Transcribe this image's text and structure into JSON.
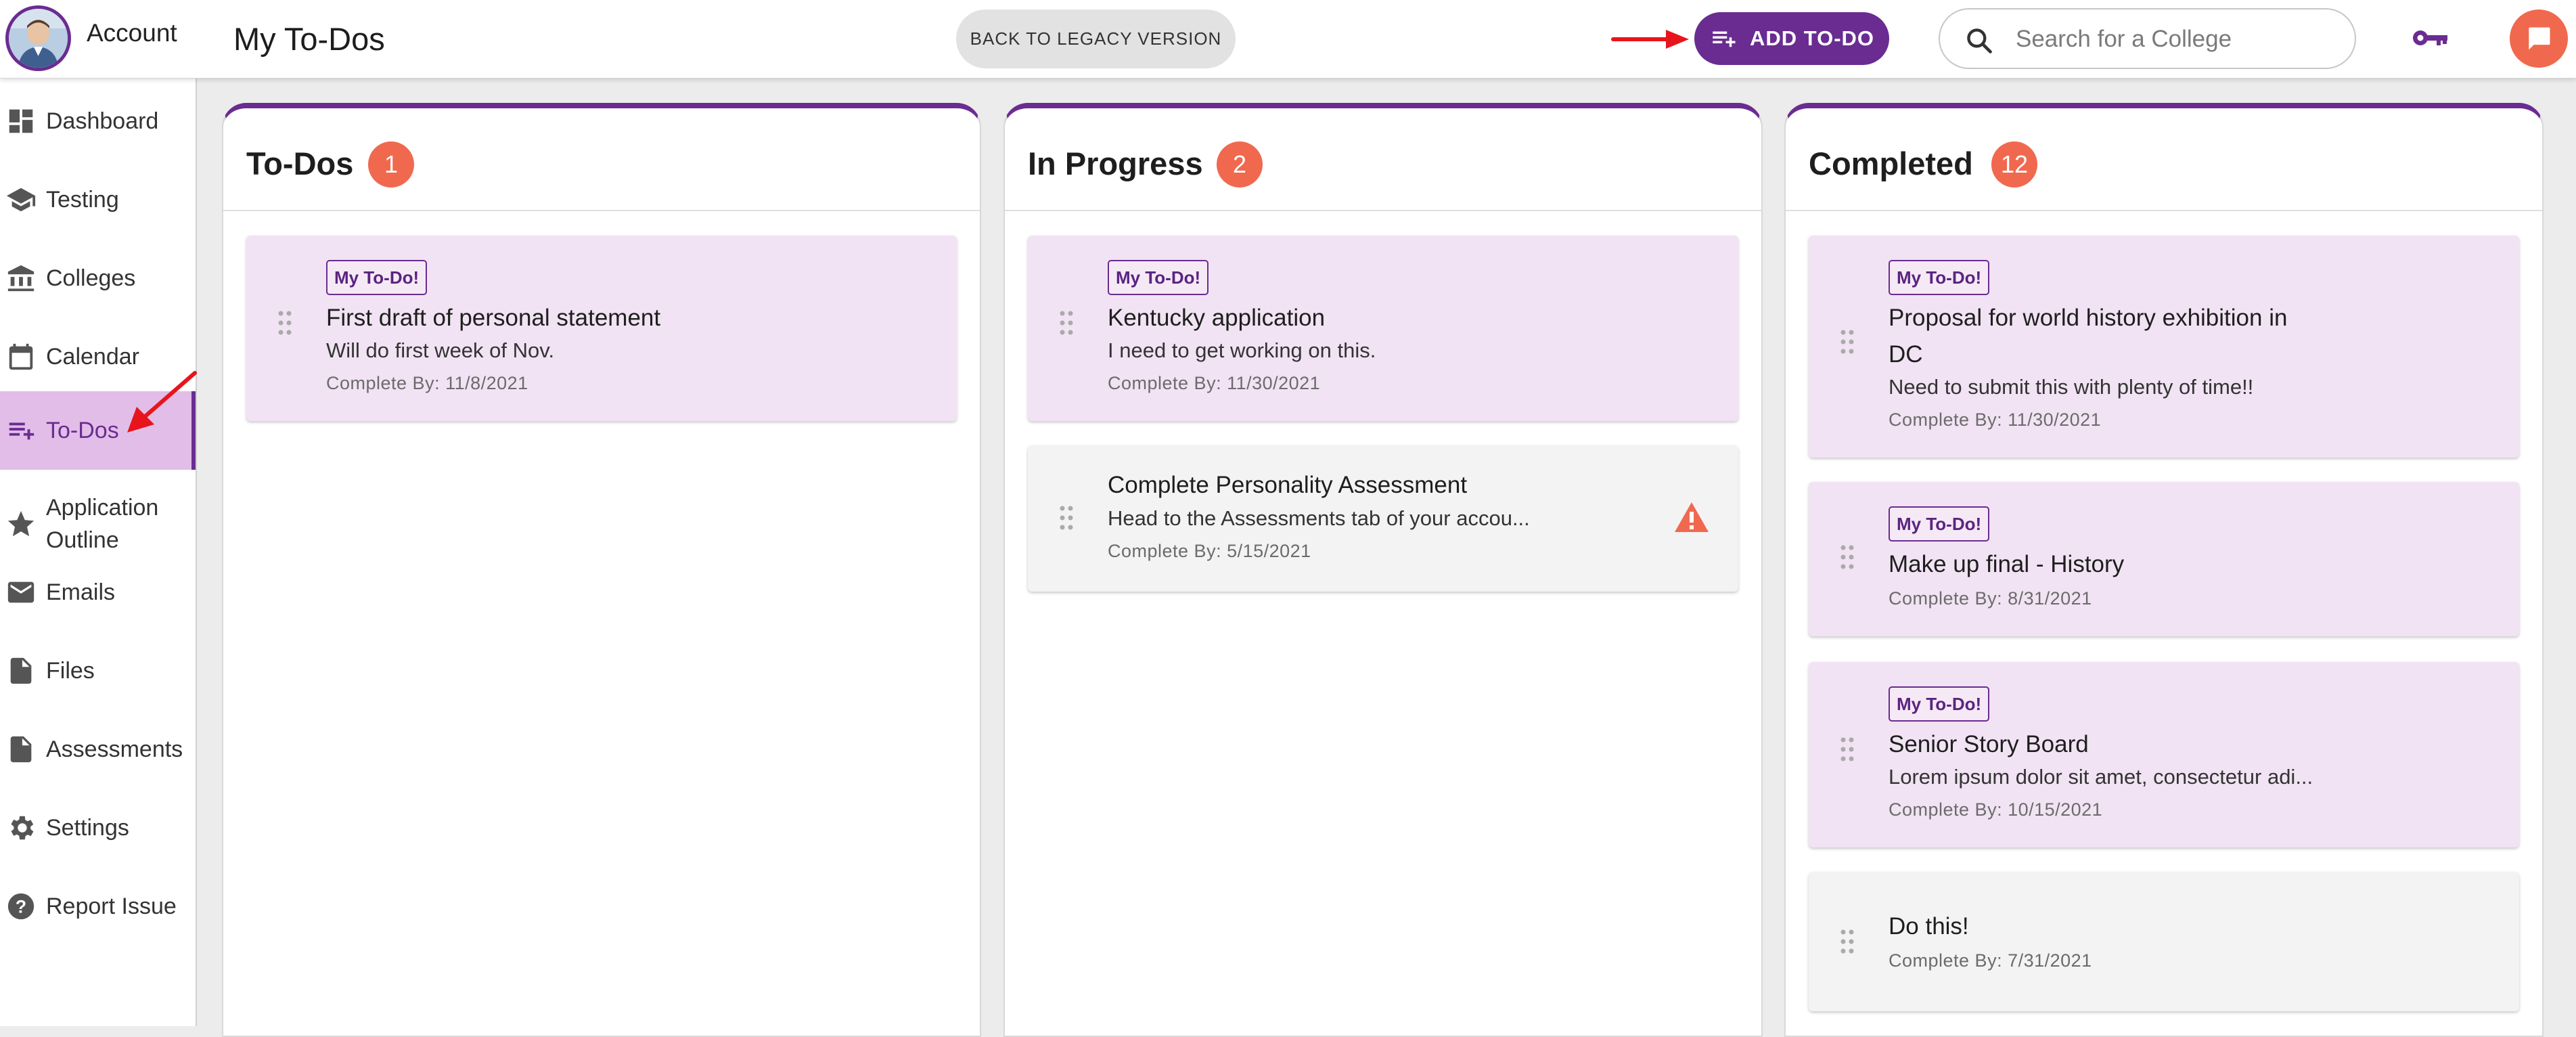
{
  "header": {
    "account_label": "Account",
    "page_title": "My To-Dos",
    "legacy_button": "BACK TO LEGACY VERSION",
    "add_button": "ADD TO-DO",
    "search_placeholder": "Search for a College"
  },
  "sidebar": {
    "items": [
      {
        "label": "Dashboard",
        "icon": "dashboard-icon"
      },
      {
        "label": "Testing",
        "icon": "graduation-cap-icon"
      },
      {
        "label": "Colleges",
        "icon": "bank-icon"
      },
      {
        "label": "Calendar",
        "icon": "calendar-icon"
      },
      {
        "label": "To-Dos",
        "icon": "playlist-add-icon",
        "active": true
      },
      {
        "label": "Application Outline",
        "icon": "star-icon"
      },
      {
        "label": "Emails",
        "icon": "mail-icon"
      },
      {
        "label": "Files",
        "icon": "file-icon"
      },
      {
        "label": "Assessments",
        "icon": "file-icon"
      },
      {
        "label": "Settings",
        "icon": "gear-icon"
      },
      {
        "label": "Report Issue",
        "icon": "help-icon"
      }
    ]
  },
  "columns": [
    {
      "title": "To-Dos",
      "count": "1",
      "cards": [
        {
          "tag": "My To-Do!",
          "title": "First draft of personal statement",
          "desc": "Will do first week of Nov.",
          "date": "Complete By: 11/8/2021"
        }
      ]
    },
    {
      "title": "In Progress",
      "count": "2",
      "cards": [
        {
          "tag": "My To-Do!",
          "title": "Kentucky application",
          "desc": "I need to get working on this.",
          "date": "Complete By: 11/30/2021"
        },
        {
          "title": "Complete Personality Assessment",
          "desc": "Head to the Assessments tab of your accou...",
          "date": "Complete By: 5/15/2021"
        }
      ]
    },
    {
      "title": "Completed",
      "count": "12",
      "cards": [
        {
          "tag": "My To-Do!",
          "title": "Proposal for world history exhibition in DC",
          "desc": "Need to submit this with plenty of time!!",
          "date": "Complete By: 11/30/2021"
        },
        {
          "tag": "My To-Do!",
          "title": "Make up final - History",
          "date": "Complete By: 8/31/2021"
        },
        {
          "tag": "My To-Do!",
          "title": "Senior Story Board",
          "desc": "Lorem ipsum dolor sit amet, consectetur adi...",
          "date": "Complete By: 10/15/2021"
        },
        {
          "title": "Do this!",
          "date": "Complete By: 7/31/2021"
        }
      ]
    }
  ],
  "colors": {
    "brand_purple": "#6a2c91",
    "badge_orange": "#f0694f",
    "card_purple": "#f1e3f3",
    "card_grey": "#f3f3f3",
    "active_nav": "#e2bde8",
    "annotation_arrow": "#e8141b"
  }
}
